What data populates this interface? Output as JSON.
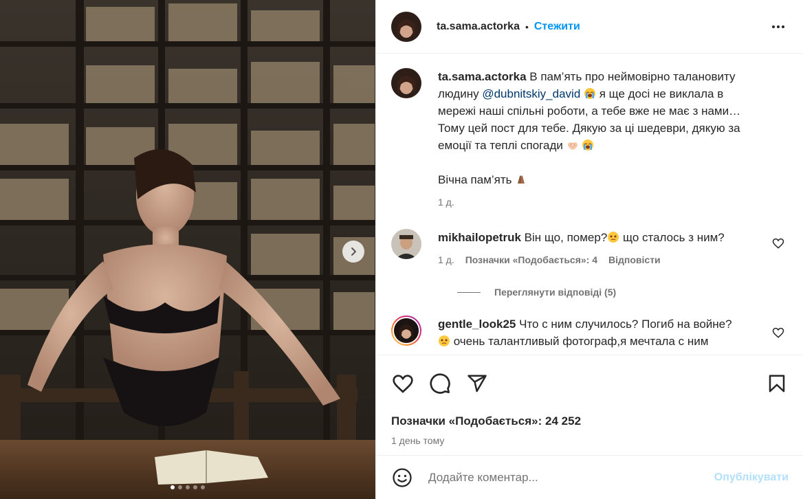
{
  "post": {
    "author": "ta.sama.actorka",
    "separator": "•",
    "follow_label": "Стежити",
    "more_icon": "more-horizontal-icon"
  },
  "media": {
    "next_icon": "chevron-right-icon",
    "slide_count": 5,
    "active_slide": 1
  },
  "caption": {
    "username": "ta.sama.actorka",
    "text_1": "В пам’ять про неймовірно талановиту людину ",
    "mention": "@dubnitskiy_david",
    "text_2": " я ще досі не виклала в мережі наші спільні роботи, а тебе вже не має з нами… Тому цей пост для тебе. Дякую за ці шедеври, дякую за емоції та теплі спогади ",
    "text_3": "Вічна пам’ять ",
    "time": "1 д."
  },
  "comments": [
    {
      "username": "mikhailopetruk",
      "text_1": "Він що, помер?",
      "text_2": " що сталось з ним?",
      "time": "1 д.",
      "likes": "Позначки «Подобається»: 4",
      "reply_label": "Відповісти"
    },
    {
      "username": "gentle_look25",
      "text_1": "Что с ним случилось? Погиб на войне? ",
      "text_2": " очень талантливый фотограф,я мечтала с ним"
    }
  ],
  "view_replies_label": "Переглянути відповіді (5)",
  "actions": {
    "like_icon": "heart-icon",
    "comment_icon": "comment-icon",
    "share_icon": "share-icon",
    "save_icon": "bookmark-icon"
  },
  "likes_text": "Позначки «Подобається»: 24 252",
  "date_text": "1 день тому",
  "add_comment": {
    "placeholder": "Додайте коментар...",
    "publish_label": "Опублікувати"
  },
  "colors": {
    "link_blue": "#0095f6",
    "mention_blue": "#00376b",
    "publish_disabled": "#b2dffc",
    "secondary_text": "#737373"
  }
}
